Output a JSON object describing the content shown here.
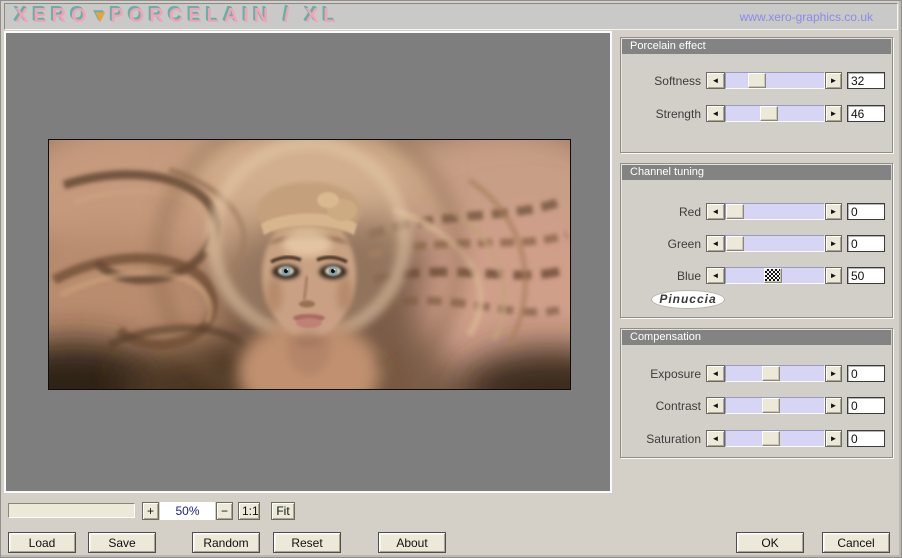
{
  "titlebar": {
    "logo_xero": "XERO",
    "logo_triangle": "▼",
    "logo_rest": "PORCELAIN / XL",
    "url": "www.xero-graphics.co.uk"
  },
  "icons": {
    "arrow_left": "◄",
    "arrow_right": "►"
  },
  "sections": {
    "porcelain": {
      "title": "Porcelain effect",
      "sliders": [
        {
          "label": "Softness",
          "value": "32",
          "pos": 0.28,
          "thumb": "normal"
        },
        {
          "label": "Strength",
          "value": "46",
          "pos": 0.43,
          "thumb": "normal"
        }
      ]
    },
    "channel": {
      "title": "Channel tuning",
      "watermark": "Pinuccia",
      "sliders": [
        {
          "label": "Red",
          "value": "0",
          "pos": 0.0,
          "thumb": "normal"
        },
        {
          "label": "Green",
          "value": "0",
          "pos": 0.0,
          "thumb": "normal"
        },
        {
          "label": "Blue",
          "value": "50",
          "pos": 0.47,
          "thumb": "checker"
        }
      ]
    },
    "compensation": {
      "title": "Compensation",
      "sliders": [
        {
          "label": "Exposure",
          "value": "0",
          "pos": 0.45,
          "thumb": "normal"
        },
        {
          "label": "Contrast",
          "value": "0",
          "pos": 0.45,
          "thumb": "normal"
        },
        {
          "label": "Saturation",
          "value": "0",
          "pos": 0.45,
          "thumb": "normal"
        }
      ]
    }
  },
  "zoombar": {
    "zoom_in": "+",
    "zoom_level": "50%",
    "zoom_out": "−",
    "one_to_one": "1:1",
    "fit": "Fit"
  },
  "buttons": {
    "load": "Load",
    "save": "Save",
    "random": "Random",
    "reset": "Reset",
    "about": "About",
    "ok": "OK",
    "cancel": "Cancel"
  },
  "colors": {
    "dialog_bg": "#d4d0c8",
    "preview_bg": "#7e7e7e",
    "section_header_bg": "#838383",
    "slider_track": "#d6d6f4",
    "control_face": "#ece9d8",
    "logo_pink": "#f0a4ba",
    "logo_teal": "#67b0a6",
    "logo_orange": "#e8a33c",
    "url_text": "#8a8aec",
    "zoom_text": "#1c1c86"
  }
}
